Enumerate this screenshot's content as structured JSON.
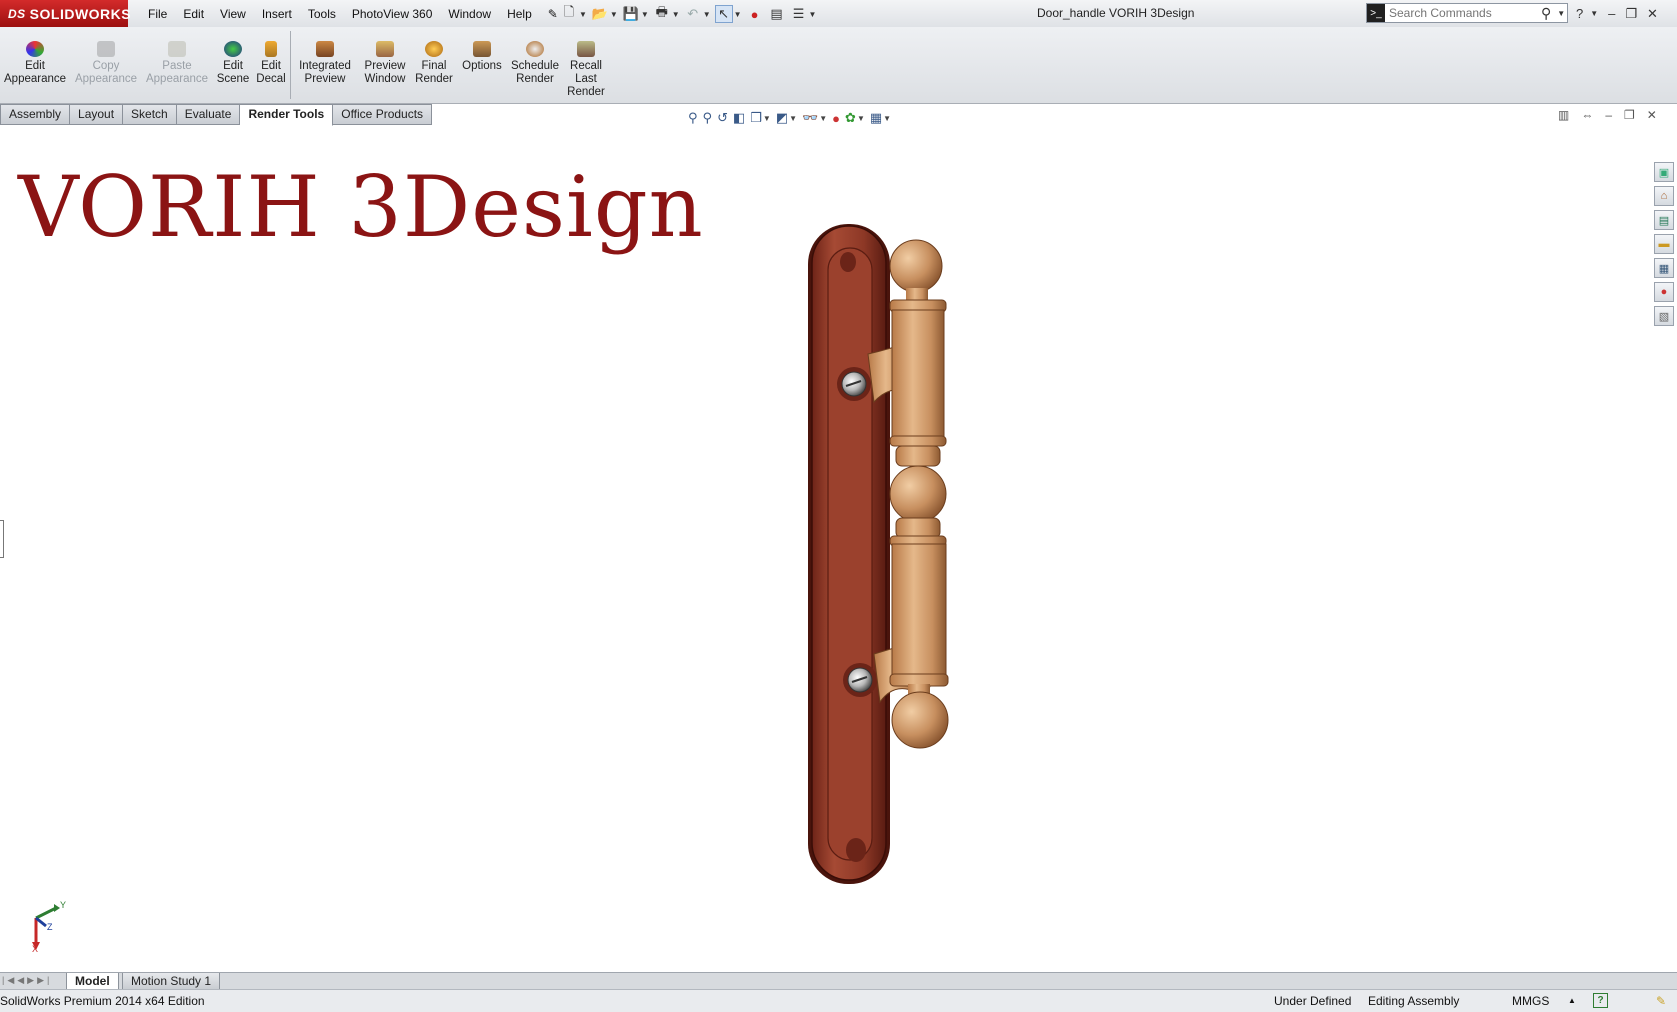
{
  "app": {
    "logo": "SOLIDWORKS",
    "doc_title": "Door_handle VORIH 3Design"
  },
  "menu": [
    "File",
    "Edit",
    "View",
    "Insert",
    "Tools",
    "PhotoView 360",
    "Window",
    "Help"
  ],
  "search": {
    "placeholder": "Search Commands"
  },
  "ribbon": {
    "edit_appearance": "Edit Appearance",
    "copy_appearance": "Copy Appearance",
    "paste_appearance": "Paste Appearance",
    "edit_scene": "Edit Scene",
    "edit_decal": "Edit Decal",
    "integrated_preview": "Integrated Preview",
    "preview_window": "Preview Window",
    "final_render": "Final Render",
    "options": "Options",
    "schedule_render": "Schedule Render",
    "recall_last_render": "Recall Last Render"
  },
  "tabs": [
    "Assembly",
    "Layout",
    "Sketch",
    "Evaluate",
    "Render Tools",
    "Office Products"
  ],
  "active_tab": "Render Tools",
  "graphics": {
    "watermark": "VORIH 3Design",
    "triad": {
      "y": "Y",
      "z": "Z",
      "x": "X"
    }
  },
  "bottom_tabs": [
    "Model",
    "Motion Study 1"
  ],
  "status": {
    "edition": "SolidWorks Premium 2014 x64 Edition",
    "definition": "Under Defined",
    "mode": "Editing Assembly",
    "units": "MMGS",
    "help": "?"
  },
  "colors": {
    "watermark": "#8b1414",
    "logo_bg": "#b11d1d",
    "plate": "#8a3424",
    "handle": "#c99565"
  }
}
